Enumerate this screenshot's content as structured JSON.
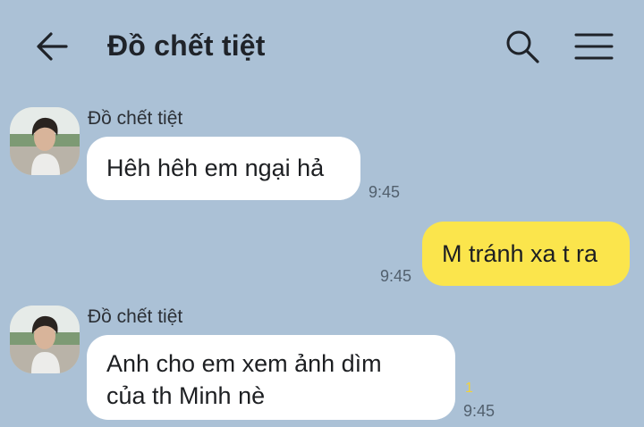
{
  "header": {
    "title": "Đồ chết tiệt",
    "icons": {
      "back": "arrow-left-icon",
      "search": "search-icon",
      "menu": "hamburger-menu-icon"
    }
  },
  "colors": {
    "background": "#abc1d6",
    "incoming_bubble": "#ffffff",
    "outgoing_bubble": "#fbe54c",
    "unread": "#f2d23a"
  },
  "messages": [
    {
      "direction": "incoming",
      "sender": "Đồ chết tiệt",
      "lines": [
        "Hêh hêh em ngại hả"
      ],
      "time": "9:45"
    },
    {
      "direction": "outgoing",
      "lines": [
        "M tránh xa t ra"
      ],
      "time": "9:45"
    },
    {
      "direction": "incoming",
      "sender": "Đồ chết tiệt",
      "lines": [
        "Anh cho em xem ảnh dìm",
        "của th Minh nè"
      ],
      "time": "9:45",
      "unread": "1"
    }
  ]
}
